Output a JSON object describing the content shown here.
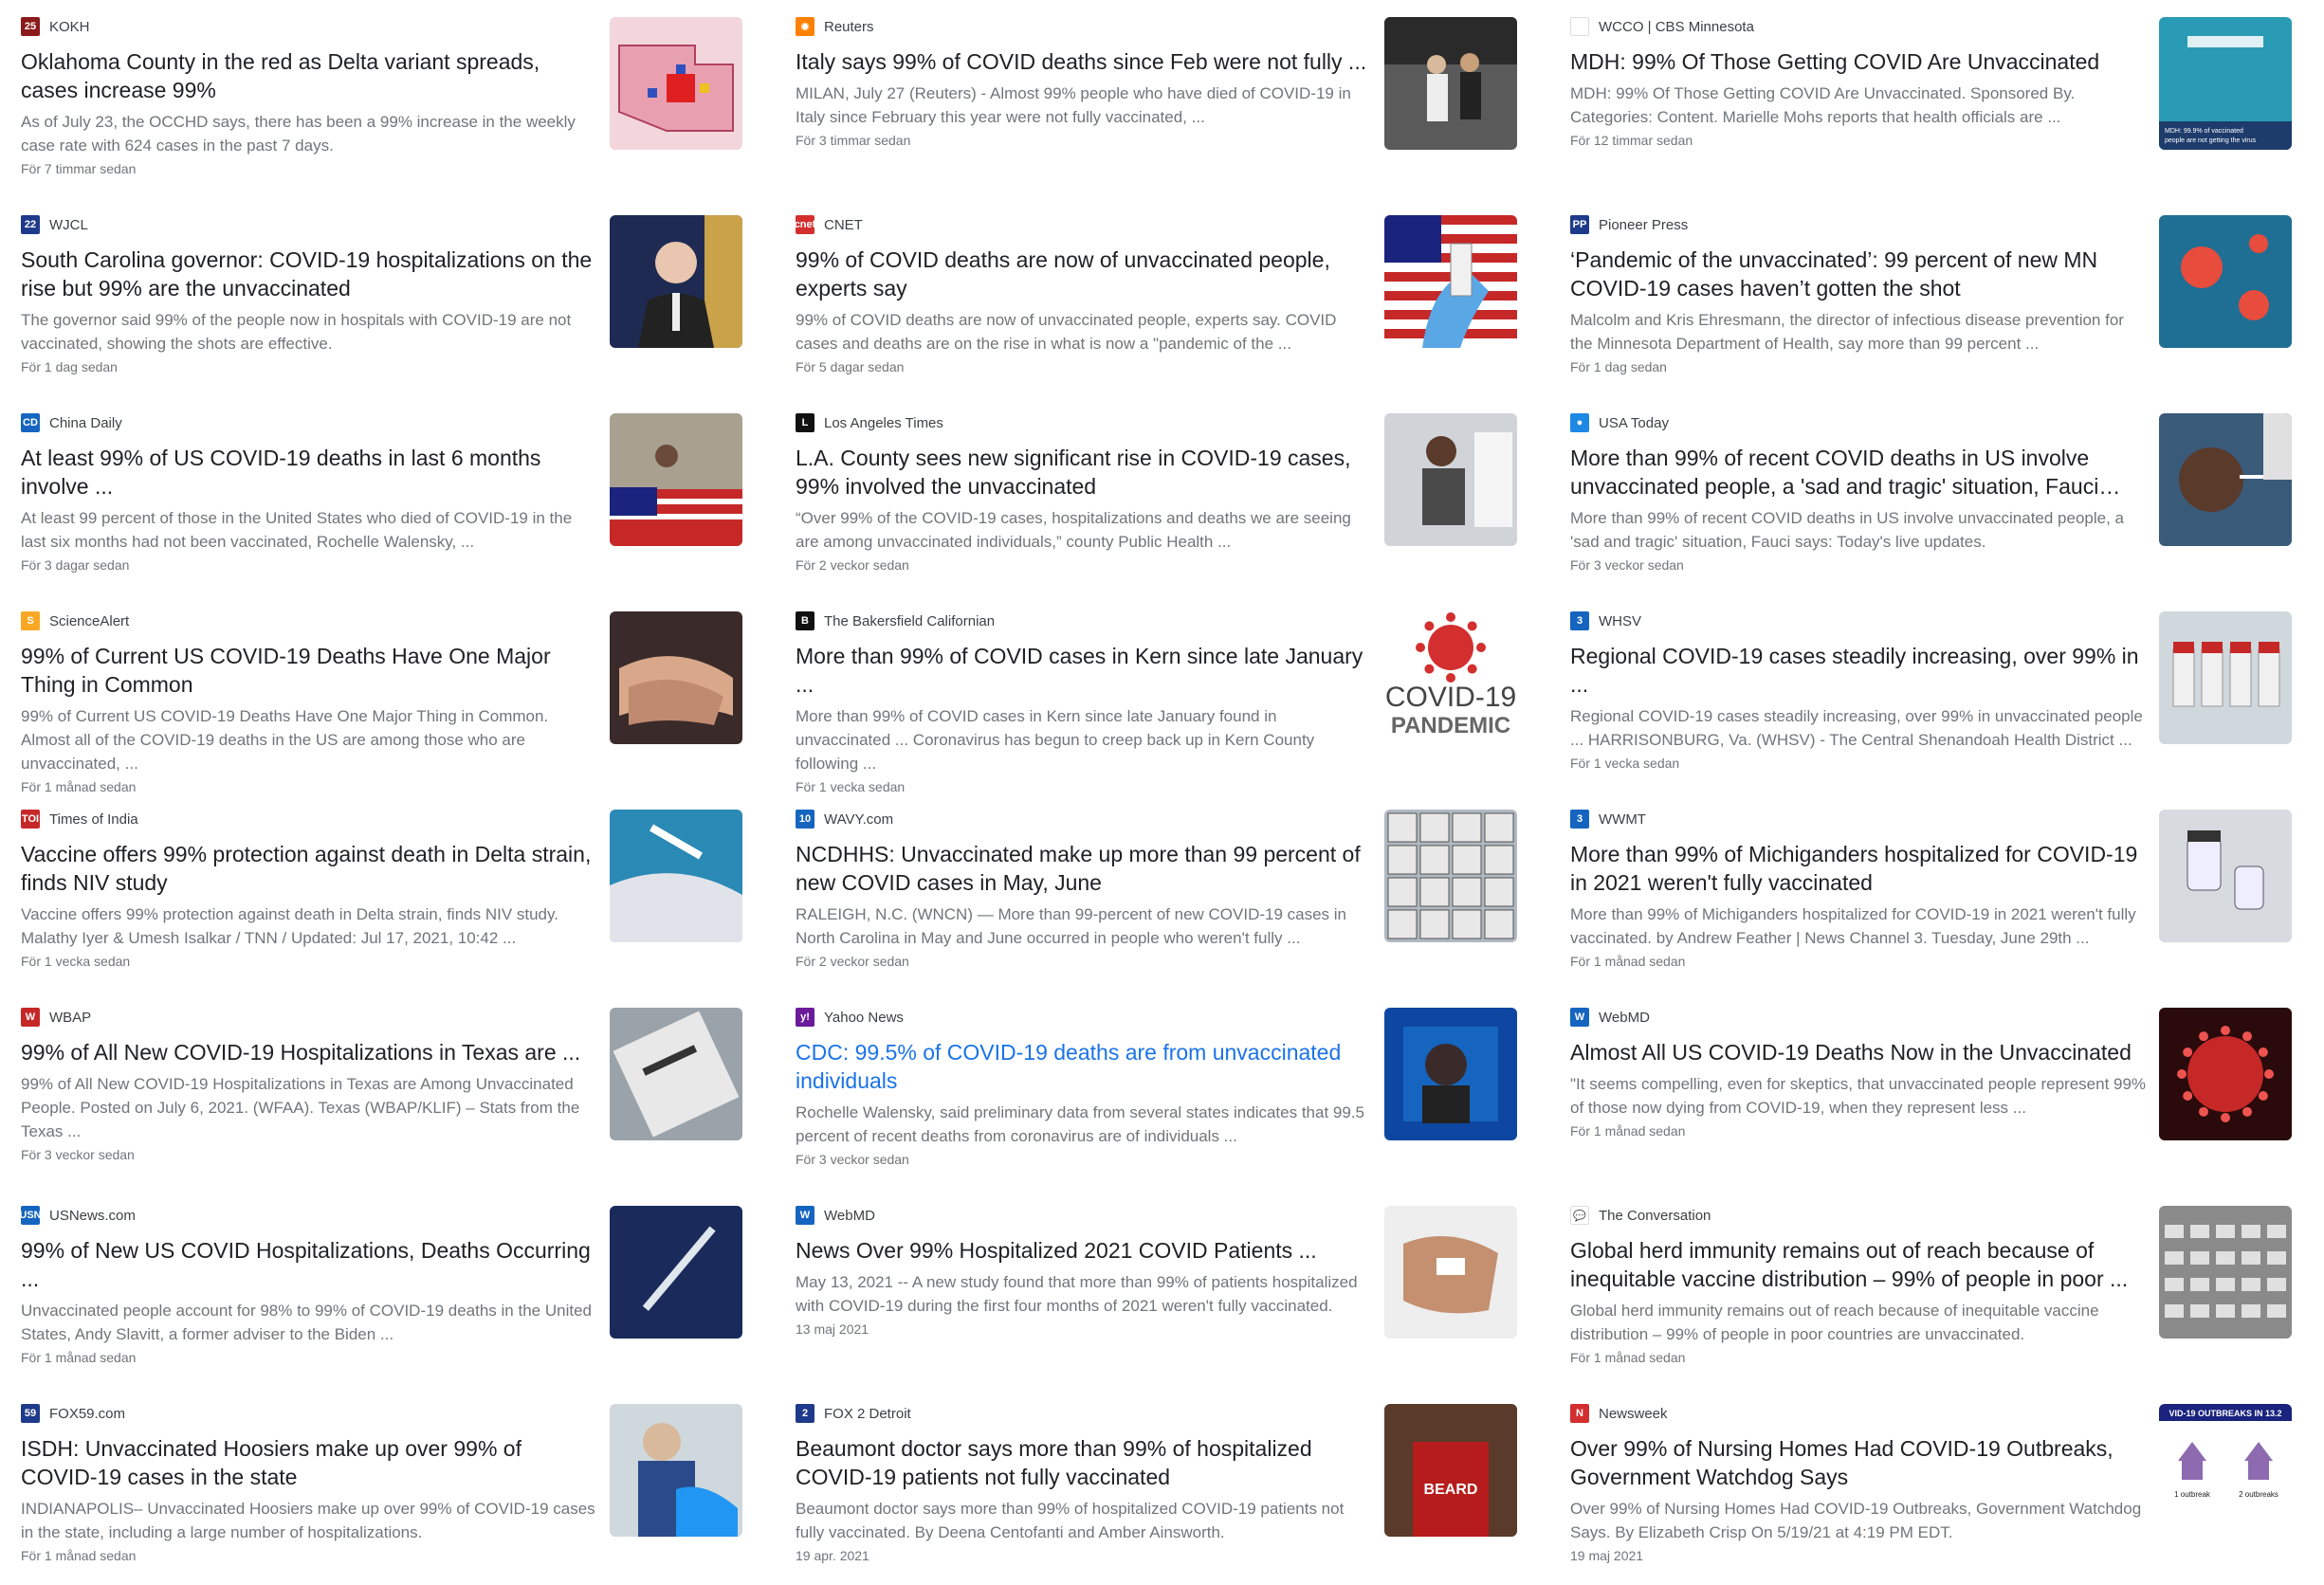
{
  "cards": [
    {
      "source": "KOKH",
      "icon": "25",
      "icon_color": "#8b1a1a",
      "title": "Oklahoma County in the red as Delta variant spreads, cases increase 99%",
      "snippet": "As of July 23, the OCCHD says, there has been a 99% increase in the weekly case rate with 624 cases in the past 7 days.",
      "time": "För 7 timmar sedan",
      "thumb": "map"
    },
    {
      "source": "Reuters",
      "icon": "✹",
      "icon_color": "#ff8000",
      "title": "Italy says 99% of COVID deaths since Feb were not fully ...",
      "snippet": "MILAN, July 27 (Reuters) - Almost 99% people who have died of COVID-19 in Italy since February this year were not fully vaccinated, ...",
      "time": "För 3 timmar sedan",
      "thumb": "street"
    },
    {
      "source": "WCCO | CBS Minnesota",
      "icon": "",
      "icon_color": "#ffffff",
      "title": "MDH: 99% Of Those Getting COVID Are Unvaccinated",
      "snippet": "MDH: 99% Of Those Getting COVID Are Unvaccinated. Sponsored By. Categories: Content. Marielle Mohs reports that health officials are ...",
      "time": "För 12 timmar sedan",
      "thumb": "vaccinate"
    },
    {
      "source": "WJCL",
      "icon": "22",
      "icon_color": "#1e3a8a",
      "title": "South Carolina governor: COVID-19 hospitalizations on the rise but 99% are the unvaccinated",
      "snippet": "The governor said 99% of the people now in hospitals with COVID-19 are not vaccinated, showing the shots are effective.",
      "time": "För 1 dag sedan",
      "thumb": "governor"
    },
    {
      "source": "CNET",
      "icon": "cnet",
      "icon_color": "#d32f2f",
      "title": "99% of COVID deaths are now of unvaccinated people, experts say",
      "snippet": "99% of COVID deaths are now of unvaccinated people, experts say. COVID cases and deaths are on the rise in what is now a \"pandemic of the ...",
      "time": "För 5 dagar sedan",
      "thumb": "flagvial"
    },
    {
      "source": "Pioneer Press",
      "icon": "PP",
      "icon_color": "#1e3a8a",
      "title": "‘Pandemic of the unvaccinated’: 99 percent of new MN COVID-19 cases haven’t gotten the shot",
      "snippet": "Malcolm and Kris Ehresmann, the director of infectious disease prevention for the Minnesota Department of Health, say more than 99 percent ...",
      "time": "För 1 dag sedan",
      "thumb": "virusblue"
    },
    {
      "source": "China Daily",
      "icon": "CD",
      "icon_color": "#1565c0",
      "title": "At least 99% of US COVID-19 deaths in last 6 months involve ...",
      "snippet": "At least 99 percent of those in the United States who died of COVID-19 in the last six months had not been vaccinated, Rochelle Walensky, ...",
      "time": "För 3 dagar sedan",
      "thumb": "funeral"
    },
    {
      "source": "Los Angeles Times",
      "icon": "L",
      "icon_color": "#111111",
      "title": "L.A. County sees new significant rise in COVID-19 cases, 99% involved the unvaccinated",
      "snippet": "“Over 99% of the COVID-19 cases, hospitalizations and deaths we are seeing are among unvaccinated individuals,” county Public Health ...",
      "time": "För 2 veckor sedan",
      "thumb": "worker"
    },
    {
      "source": "USA Today",
      "icon": "●",
      "icon_color": "#1e88e5",
      "title": "More than 99% of recent COVID deaths in US involve unvaccinated people, a 'sad and tragic' situation, Fauci says: ...",
      "snippet": "More than 99% of recent COVID deaths in US involve unvaccinated people, a 'sad and tragic' situation, Fauci says: Today's live updates.",
      "time": "För 3 veckor sedan",
      "thumb": "swab"
    },
    {
      "source": "ScienceAlert",
      "icon": "S",
      "icon_color": "#f9a825",
      "title": "99% of Current US COVID-19 Deaths Have One Major Thing in Common",
      "snippet": "99% of Current US COVID-19 Deaths Have One Major Thing in Common. Almost all of the COVID-19 deaths in the US are among those who are unvaccinated, ...",
      "time": "För 1 månad sedan",
      "thumb": "hands"
    },
    {
      "source": "The Bakersfield Californian",
      "icon": "B",
      "icon_color": "#111111",
      "title": "More than 99% of COVID cases in Kern since late January ...",
      "snippet": "More than 99% of COVID cases in Kern since late January found in unvaccinated ... Coronavirus has begun to creep back up in Kern County following ...",
      "time": "För 1 vecka sedan",
      "thumb": "pandemic"
    },
    {
      "source": "WHSV",
      "icon": "3",
      "icon_color": "#1565c0",
      "title": "Regional COVID-19 cases steadily increasing, over 99% in ...",
      "snippet": "Regional COVID-19 cases steadily increasing, over 99% in unvaccinated people ... HARRISONBURG, Va. (WHSV) - The Central Shenandoah Health District ...",
      "time": "För 1 vecka sedan",
      "thumb": "vials"
    },
    {
      "source": "Times of India",
      "icon": "TOI",
      "icon_color": "#c62828",
      "title": "Vaccine offers 99% protection against death in Delta strain, finds NIV study",
      "snippet": "Vaccine offers 99% protection against death in Delta strain, finds NIV study. Malathy Iyer & Umesh Isalkar / TNN / Updated: Jul 17, 2021, 10:42 ...",
      "time": "För 1 vecka sedan",
      "thumb": "injection"
    },
    {
      "source": "WAVY.com",
      "icon": "10",
      "icon_color": "#1565c0",
      "title": "NCDHHS: Unvaccinated make up more than 99 percent of new COVID cases in May, June",
      "snippet": "RALEIGH, N.C. (WNCN) — More than 99-percent of new COVID-19 cases in North Carolina in May and June occurred in people who weren't fully ...",
      "time": "För 2 veckor sedan",
      "thumb": "boxes"
    },
    {
      "source": "WWMT",
      "icon": "3",
      "icon_color": "#1565c0",
      "title": "More than 99% of Michiganders hospitalized for COVID-19 in 2021 weren't fully vaccinated",
      "snippet": "More than 99% of Michiganders hospitalized for COVID-19 in 2021 weren't fully vaccinated. by Andrew Feather | News Channel 3. Tuesday, June 29th ...",
      "time": "För 1 månad sedan",
      "thumb": "bottles"
    },
    {
      "source": "WBAP",
      "icon": "W",
      "icon_color": "#c62828",
      "title": "99% of All New COVID-19 Hospitalizations in Texas are ...",
      "snippet": "99% of All New COVID-19 Hospitalizations in Texas are Among Unvaccinated People. Posted on July 6, 2021. (WFAA). Texas (WBAP/KLIF) – Stats from the Texas ...",
      "time": "För 3 veckor sedan",
      "thumb": "vaccinebox"
    },
    {
      "source": "Yahoo News",
      "icon": "y!",
      "icon_color": "#6a1b9a",
      "title": "CDC: 99.5% of COVID-19 deaths are from unvaccinated individuals",
      "snippet": "Rochelle Walensky, said preliminary data from several states indicates that 99.5 percent of recent deaths from coronavirus are of individuals ...",
      "time": "För 3 veckor sedan",
      "thumb": "video",
      "link": true
    },
    {
      "source": "WebMD",
      "icon": "W",
      "icon_color": "#1565c0",
      "title": "Almost All US COVID-19 Deaths Now in the Unvaccinated",
      "snippet": "\"It seems compelling, even for skeptics, that unvaccinated people represent 99% of those now dying from COVID-19, when they represent less ...",
      "time": "För 1 månad sedan",
      "thumb": "virusred"
    },
    {
      "source": "USNews.com",
      "icon": "USN",
      "icon_color": "#1565c0",
      "title": "99% of New US COVID Hospitalizations, Deaths Occurring ...",
      "snippet": "Unvaccinated people account for 98% to 99% of COVID-19 deaths in the United States, Andy Slavitt, a former adviser to the Biden ...",
      "time": "För 1 månad sedan",
      "thumb": "syringe"
    },
    {
      "source": "WebMD",
      "icon": "W",
      "icon_color": "#1565c0",
      "title": "News Over 99% Hospitalized 2021 COVID Patients ...",
      "snippet": "May 13, 2021 -- A new study found that more than 99% of patients hospitalized with COVID-19 during the first four months of 2021 weren't fully vaccinated.",
      "time": "13 maj 2021",
      "thumb": "ivhand"
    },
    {
      "source": "The Conversation",
      "icon": "💬",
      "icon_color": "#ffffff",
      "title": "Global herd immunity remains out of reach because of inequitable vaccine distribution – 99% of people in poor ...",
      "snippet": "Global herd immunity remains out of reach because of inequitable vaccine distribution – 99% of people in poor countries are unvaccinated.",
      "time": "För 1 månad sedan",
      "thumb": "hall"
    },
    {
      "source": "FOX59.com",
      "icon": "59",
      "icon_color": "#1e3a8a",
      "title": "ISDH: Unvaccinated Hoosiers make up over 99% of COVID-19 cases in the state",
      "snippet": "INDIANAPOLIS– Unvaccinated Hoosiers make up over 99% of COVID-19 cases in the state, including a large number of hospitalizations.",
      "time": "För 1 månad sedan",
      "thumb": "gloves"
    },
    {
      "source": "FOX 2 Detroit",
      "icon": "2",
      "icon_color": "#1e3a8a",
      "title": "Beaumont doctor says more than 99% of hospitalized COVID-19 patients not fully vaccinated",
      "snippet": "Beaumont doctor says more than 99% of hospitalized COVID-19 patients not fully vaccinated. By Deena Centofanti and Amber Ainsworth.",
      "time": "19 apr. 2021",
      "thumb": "jersey"
    },
    {
      "source": "Newsweek",
      "icon": "N",
      "icon_color": "#d32f2f",
      "title": "Over 99% of Nursing Homes Had COVID-19 Outbreaks, Government Watchdog Says",
      "snippet": "Over 99% of Nursing Homes Had COVID-19 Outbreaks, Government Watchdog Says. By Elizabeth Crisp On 5/19/21 at 4:19 PM EDT.",
      "time": "19 maj 2021",
      "thumb": "outbreaks"
    }
  ],
  "thumb_text": {
    "vaccinate": "MDH: 99.9% of vaccinated",
    "vaccinate2": "people are not getting the virus",
    "pandemic1": "COVID-19",
    "pandemic2": "PANDEMIC",
    "outbreaks": "VID-19 OUTBREAKS IN 13.2",
    "outb1": "1 outbreak",
    "outb2": "2 outbreaks",
    "jersey": "BEARD"
  }
}
